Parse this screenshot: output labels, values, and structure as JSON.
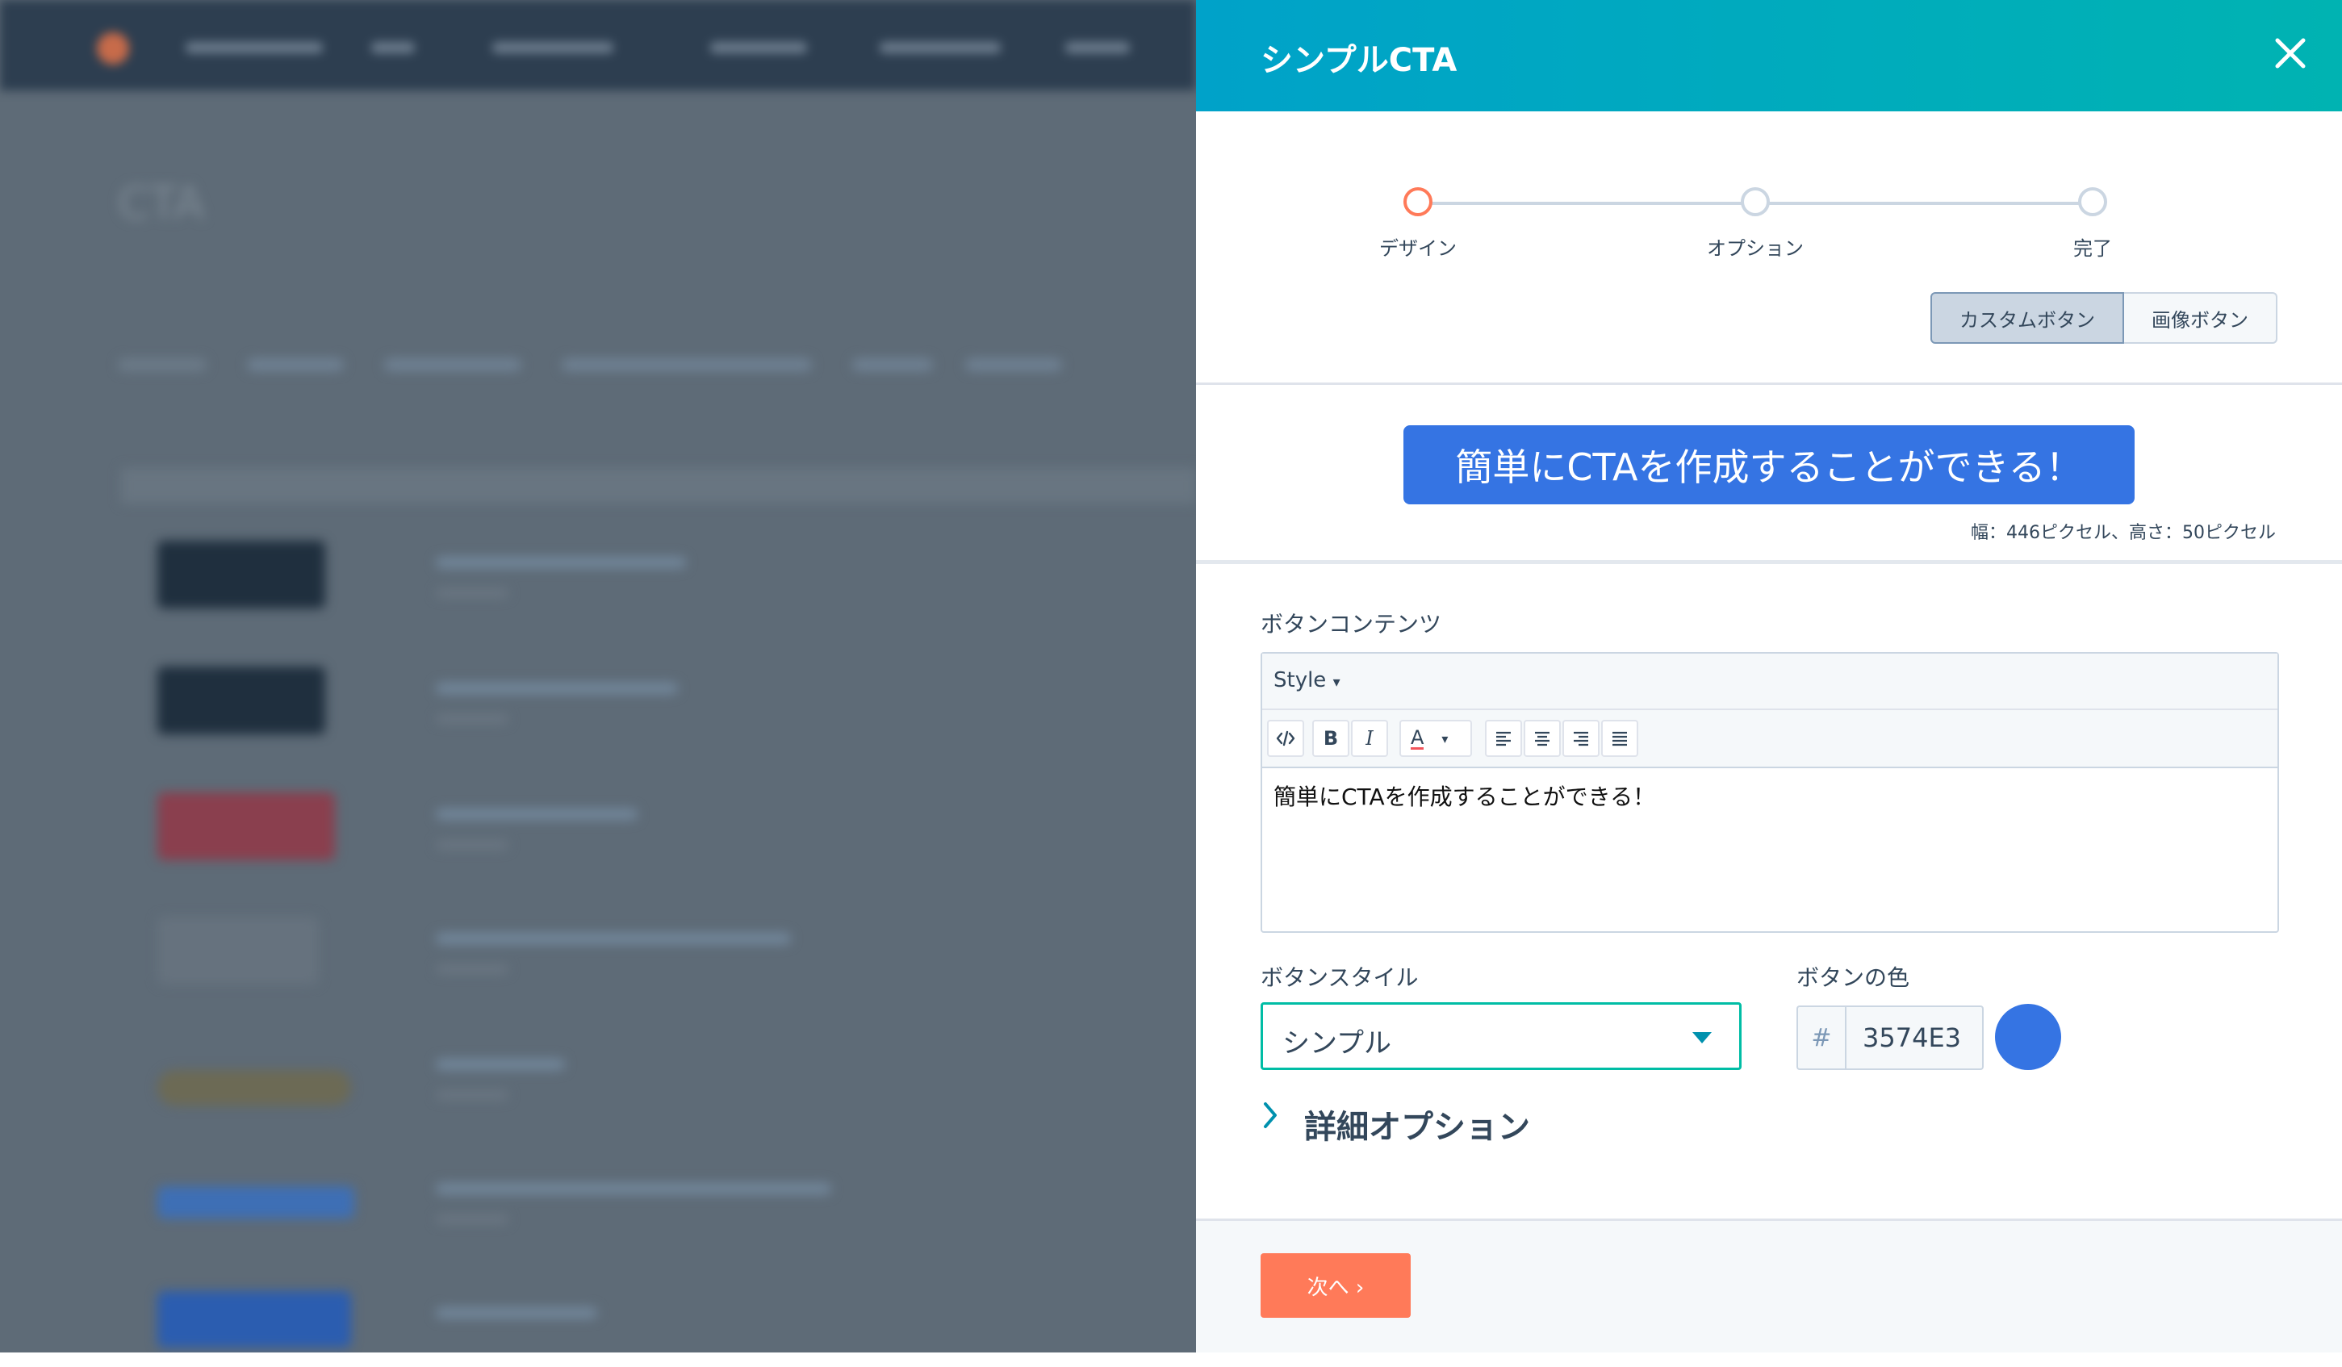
{
  "background": {
    "page_title": "CTA"
  },
  "panel": {
    "title": "シンプルCTA",
    "steps": [
      {
        "label": "デザイン",
        "active": true
      },
      {
        "label": "オプション",
        "active": false
      },
      {
        "label": "完了",
        "active": false
      }
    ],
    "button_type": {
      "options": [
        "カスタムボタン",
        "画像ボタン"
      ],
      "selected": "カスタムボタン"
    },
    "preview": {
      "text": "簡単にCTAを作成することができる！",
      "dimensions": "幅：446ピクセル、高さ：50ピクセル"
    },
    "content_section": {
      "label": "ボタンコンテンツ",
      "style_menu": "Style",
      "editor_text": "簡単にCTAを作成することができる！"
    },
    "style_section": {
      "label": "ボタンスタイル",
      "selected": "シンプル"
    },
    "color_section": {
      "label": "ボタンの色",
      "hash": "#",
      "value": "3574E3",
      "swatch_color": "#3574e3"
    },
    "advanced": {
      "label": "詳細オプション"
    },
    "footer": {
      "next_label": "次へ ›"
    }
  },
  "colors": {
    "header_start": "#00a2c9",
    "header_end": "#00b3b2",
    "accent_orange": "#ff7a59",
    "accent_teal": "#00bda5",
    "text": "#33475b"
  }
}
